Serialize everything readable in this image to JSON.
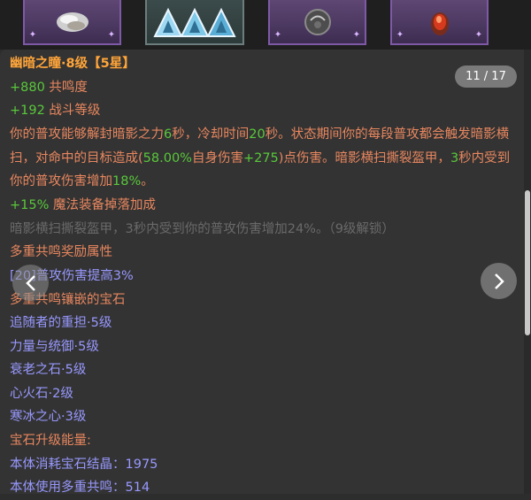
{
  "gems": [
    {
      "name": "pearl-gem",
      "accent": "#dcdcdc"
    },
    {
      "name": "frost-triangles-gem",
      "accent": "#7ec8e8"
    },
    {
      "name": "dark-orb-gem",
      "accent": "#5c5c5c"
    },
    {
      "name": "fire-stone-gem",
      "accent": "#d63a1e"
    }
  ],
  "counter": "11 / 17",
  "item": {
    "name": "幽暗之瞳·8级",
    "stars": "【5星】",
    "stat1_value": "+880",
    "stat1_label": " 共鸣度",
    "stat2_value": "+192",
    "stat2_label": " 战斗等级",
    "desc_p1": "你的普攻能够解封暗影之力",
    "desc_n1": "6",
    "desc_p2": "秒，冷却时间",
    "desc_n2": "20",
    "desc_p3": "秒。状态期间你的每段普攻都会触发暗影横扫，对命中的目标造成(",
    "desc_n3": "58.00%",
    "desc_p4": "自身伤害",
    "desc_n4": "+275",
    "desc_p5": ")点伤害。暗影横扫撕裂盔甲，",
    "desc_n5": "3",
    "desc_p6": "秒内受到你的普攻伤害增加",
    "desc_n6": "18%",
    "desc_p7": "。",
    "bonus_value": "+15%",
    "bonus_label": " 魔法装备掉落加成",
    "locked_text": "暗影横扫撕裂盔甲，3秒内受到你的普攻伤害增加24%。（9级解锁）",
    "reward_header": "多重共鸣奖励属性",
    "reward_line": "[20]普攻伤害提高3%",
    "gems_header": "多重共鸣镶嵌的宝石",
    "gem_lines": [
      "追随者的重担·5级",
      "力量与统御·5级",
      "衰老之石·5级",
      "心火石·2级",
      "寒冰之心·3级"
    ],
    "energy_header": "宝石升级能量:",
    "energy1_label": "本体消耗宝石结晶：",
    "energy1_value": "1975",
    "energy2_label": "本体使用多重共鸣：",
    "energy2_value": "514"
  },
  "colors": {
    "title": "#ffa53a",
    "green": "#59c83b",
    "salmon": "#e8875f",
    "blue": "#9898ff",
    "grey": "#6a6a6a"
  }
}
